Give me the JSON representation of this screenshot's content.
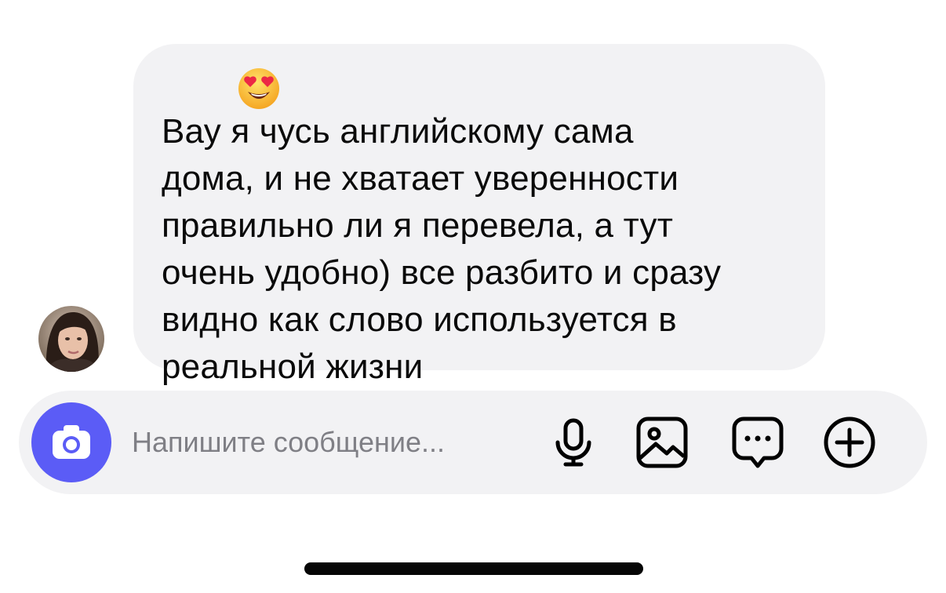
{
  "message": {
    "text_line1_start": "Вау",
    "emoji": "smiling-face-with-heart-eyes",
    "text": "Вау      я чусь английскому сама\nдома, и не хватает уверенности\nправильно ли я перевела, а тут\nочень удобно) все разбито и сразу\nвидно как слово используется в\nреальной жизни"
  },
  "composer": {
    "placeholder": "Напишите сообщение...",
    "value": ""
  },
  "icons": {
    "camera": "camera-icon",
    "mic": "microphone-icon",
    "gallery": "image-icon",
    "sticker": "chat-bubble-icon",
    "plus": "plus-circle-icon"
  },
  "colors": {
    "bubble": "#f2f2f4",
    "composer": "#f2f2f4",
    "camera_button": "#5b5cf6",
    "placeholder": "#7f7f85"
  }
}
